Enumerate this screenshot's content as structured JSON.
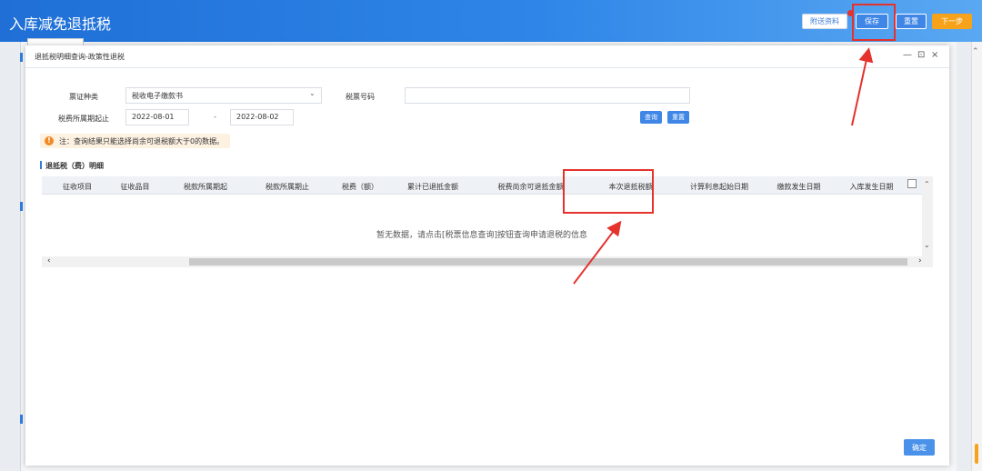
{
  "header": {
    "title": "入库减免退抵税",
    "buttons": {
      "attach": "附送资料",
      "save": "保存",
      "reset": "重置",
      "next": "下一步"
    }
  },
  "modal": {
    "title": "退抵税明细查询-政策性退税",
    "controls": {
      "minimize": "—",
      "maximize": "⊡",
      "close": "×"
    },
    "form": {
      "ticket_type_label": "票证种类",
      "ticket_type_value": "税收电子缴款书",
      "ticket_no_label": "税票号码",
      "ticket_no_value": "",
      "period_label": "税费所属期起止",
      "period_start": "2022-08-01",
      "period_sep": "-",
      "period_end": "2022-08-02",
      "query_btn": "查询",
      "reset_btn": "重置"
    },
    "notice": {
      "icon": "!",
      "text": "注：查询结果只能选择尚余可退税额大于0的数据。"
    },
    "section_title": "退抵税（费）明细",
    "table": {
      "columns": [
        "征收项目",
        "征收品目",
        "税款所属期起",
        "税款所属期止",
        "税费（额）",
        "累计已退抵金额",
        "税费尚余可退抵金额",
        "本次退抵税额",
        "计算利息起始日期",
        "缴款发生日期",
        "入库发生日期"
      ],
      "empty_text": "暂无数据，请点击[税票信息查询]按钮查询申请退税的信息"
    },
    "confirm_btn": "确定"
  },
  "colors": {
    "header_blue": "#2f86e8",
    "accent_orange": "#f6a31b",
    "annotation_red": "#e5322d"
  }
}
